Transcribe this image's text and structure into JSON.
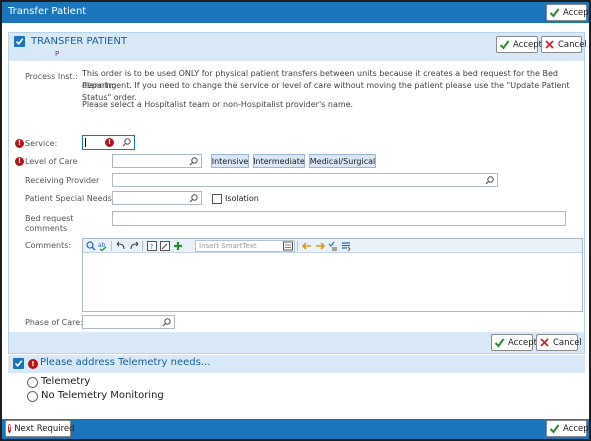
{
  "window": {
    "title": "Transfer Patient",
    "accept_label": "Accept"
  },
  "order": {
    "title": "TRANSFER PATIENT",
    "subtitle": "P",
    "accept_label": "Accept",
    "cancel_label": "Cancel",
    "process_inst_label": "Process Inst.:",
    "process_inst_line1": "This order is to be used ONLY for physical patient transfers between units because it creates a bed request for the Bed Planning",
    "process_inst_line2": "department. If you need to change the service or level of care without moving the patient please use the \"Update Patient Status\" order.",
    "process_inst_line3": "Please select a Hospitalist team or non-Hospitalist provider's name.",
    "service_label": "Service:",
    "service_value": "",
    "level_of_care_label": "Level of Care",
    "level_of_care_value": "",
    "level_options": [
      "Intensive",
      "Intermediate",
      "Medical/Surgical"
    ],
    "receiving_provider_label": "Receiving Provider",
    "receiving_provider_value": "",
    "special_needs_label": "Patient Special Needs",
    "special_needs_value": "",
    "isolation_label": "Isolation",
    "isolation_checked": false,
    "bed_request_label_1": "Bed request",
    "bed_request_label_2": "comments",
    "bed_request_value": "",
    "comments_label": "Comments:",
    "smarttext_placeholder": "Insert SmartText",
    "comments_value": "",
    "phase_of_care_label": "Phase of Care:",
    "phase_of_care_value": "",
    "footer_accept_label": "Accept",
    "footer_cancel_label": "Cancel"
  },
  "telemetry": {
    "title": "Please address Telemetry needs...",
    "options": [
      "Telemetry",
      "No Telemetry Monitoring"
    ],
    "selected": null
  },
  "bottom": {
    "next_required_label": "Next Required",
    "accept_label": "Accept"
  },
  "colors": {
    "accent_blue": "#1a75bd",
    "header_light_blue": "#d8e8f6",
    "required_red": "#b3141d",
    "accept_green": "#2f8a2f",
    "cancel_red": "#c8282d"
  }
}
